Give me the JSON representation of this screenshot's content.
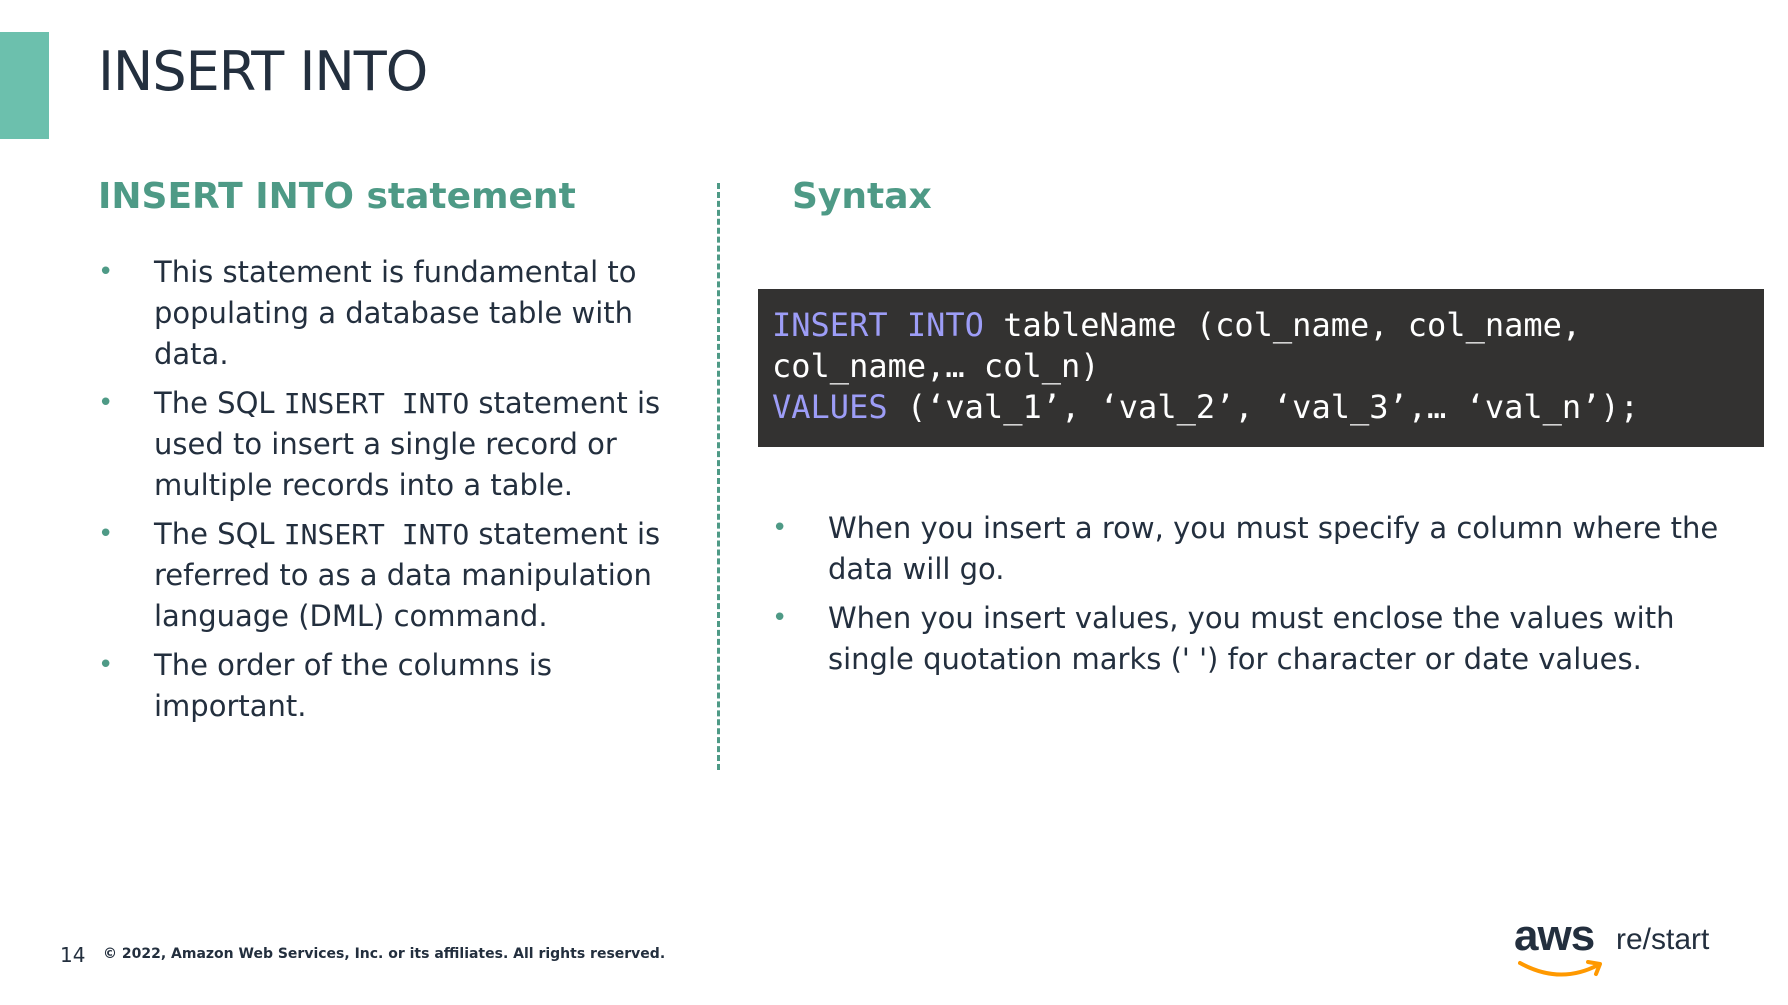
{
  "slide": {
    "title": "INSERT INTO",
    "accent_color": "#6cc0ad",
    "heading_color": "#4e9a86"
  },
  "left": {
    "heading": "INSERT INTO statement",
    "bullets": {
      "b1": "This statement is fundamental to populating a database table with data.",
      "b2_pre": "The SQL ",
      "b2_code": "INSERT INTO",
      "b2_post": " statement is used to insert a single record or multiple records into a table.",
      "b3_pre": "The SQL ",
      "b3_code": "INSERT INTO",
      "b3_post": " statement is referred to as a data manipulation language (DML) command.",
      "b4": "The order of the columns is important."
    }
  },
  "right": {
    "heading": "Syntax",
    "code": {
      "l1_kw": "INSERT INTO",
      "l1_rest": " tableName (col_name, col_name,",
      "l2": "col_name,… col_n)",
      "l3_kw": "VALUES",
      "l3_rest": " (‘val_1’, ‘val_2’, ‘val_3’,… ‘val_n’);"
    },
    "bullets": {
      "b1": "When you insert a row, you must specify a column where the data will go.",
      "b2": "When you insert values, you must enclose the values with single quotation marks (' ') for character or date values."
    }
  },
  "footer": {
    "page_number": "14",
    "copyright": "© 2022, Amazon Web Services, Inc. or its affiliates. All rights reserved.",
    "logo_aws": "aws",
    "logo_restart": "re/start"
  }
}
